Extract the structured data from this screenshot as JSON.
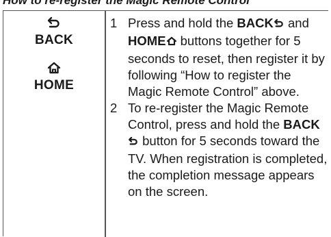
{
  "heading": "How to re-register the Magic Remote Control",
  "buttons": {
    "back": {
      "label": "BACK",
      "icon": "back-arrow-icon"
    },
    "home": {
      "label": "HOME",
      "icon": "home-icon"
    }
  },
  "steps": [
    {
      "number": "1",
      "t1": "Press and hold the ",
      "b1": "BACK",
      "t2": " and ",
      "b2": "HOME",
      "t3": " buttons together for 5 seconds to reset, then register it by following “How to register the Magic Remote Control” above."
    },
    {
      "number": "2",
      "t1": "To re-register the Magic Remote Control, press and hold the ",
      "b1": "BACK",
      "t2": " button for 5 seconds toward the TV. When registration is completed, the completion message appears on the screen."
    }
  ]
}
